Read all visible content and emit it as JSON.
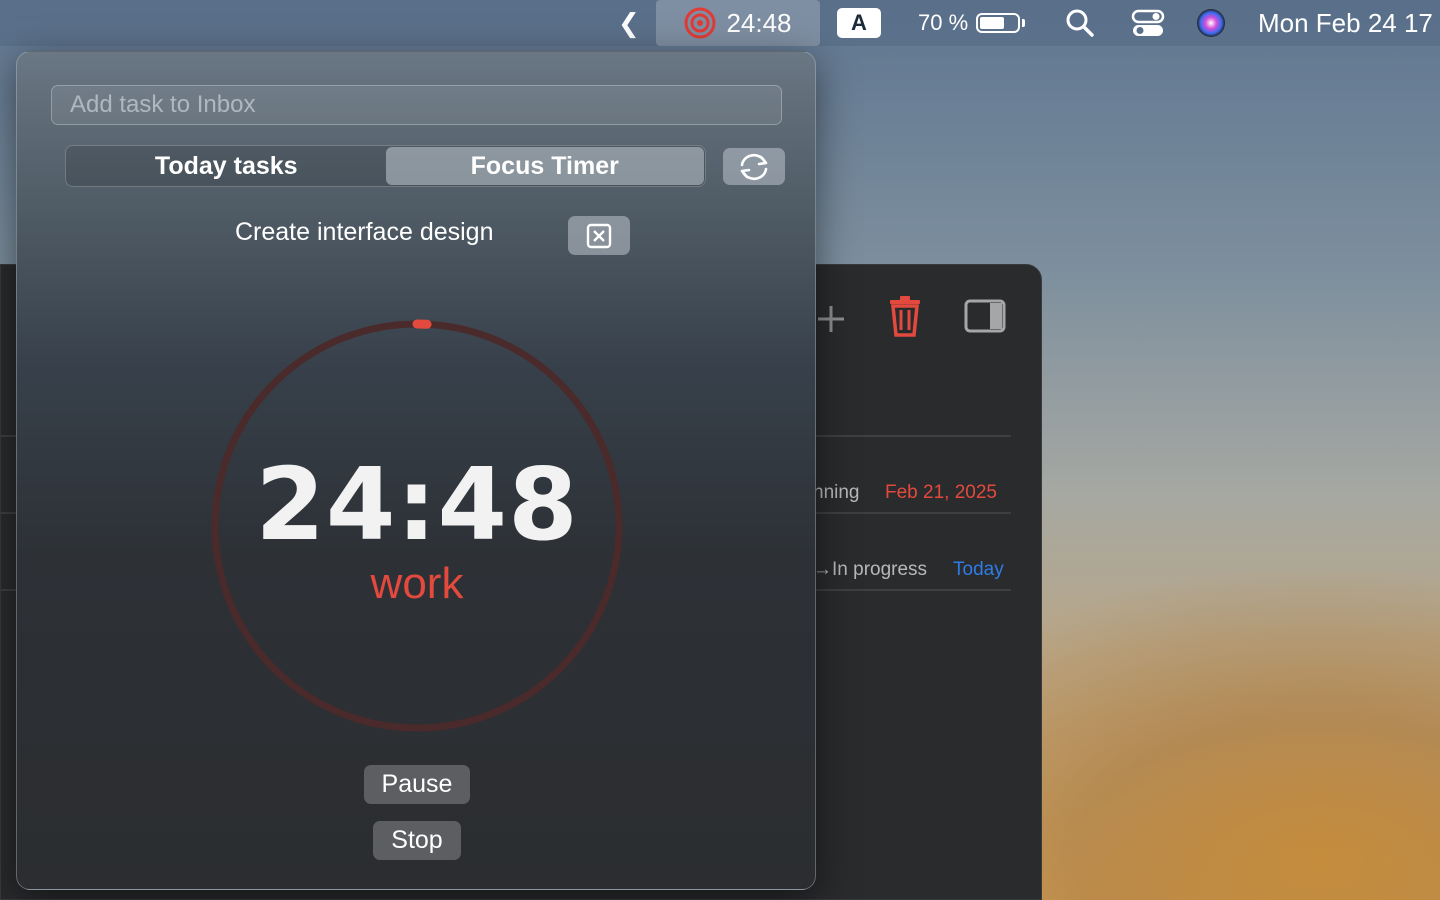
{
  "menubar": {
    "timer_text": "24:48",
    "keyboard_layout": "A",
    "battery_percent": "70 %",
    "datetime": "Mon Feb 24  17"
  },
  "background_window": {
    "rows": [
      {
        "status": "nning",
        "date": "Feb 21, 2025",
        "date_color": "#e4493d"
      },
      {
        "status": "→In progress",
        "date": "Today",
        "date_color": "#2f7ce6"
      }
    ]
  },
  "popover": {
    "task_input_placeholder": "Add task to Inbox",
    "tabs": [
      {
        "label": "Today tasks",
        "active": false
      },
      {
        "label": "Focus Timer",
        "active": true
      }
    ],
    "current_task": "Create interface design",
    "timer": {
      "time": "24:48",
      "phase": "work",
      "elapsed_fraction": 0.008,
      "accent_color": "#e4493d"
    },
    "buttons": {
      "pause": "Pause",
      "stop": "Stop"
    }
  }
}
